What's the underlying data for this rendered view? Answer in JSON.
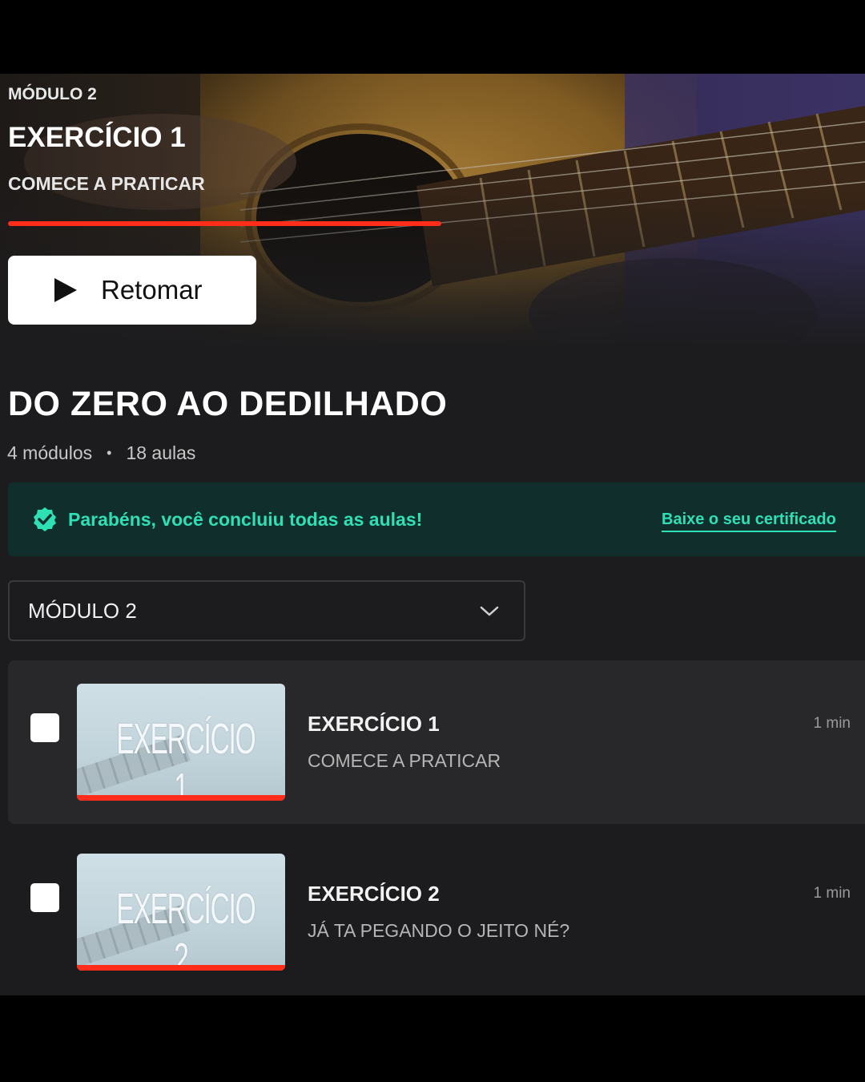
{
  "hero": {
    "module_label": "MÓDULO 2",
    "lesson_title": "EXERCÍCIO 1",
    "lesson_subtitle": "COMECE A PRATICAR",
    "progress": 1.0,
    "resume_label": "Retomar"
  },
  "course": {
    "title": "DO ZERO AO DEDILHADO",
    "modules": "4 módulos",
    "separator": "•",
    "lessons": "18 aulas"
  },
  "banner": {
    "message": "Parabéns, você concluiu todas as aulas!",
    "certificate_link": "Baixe o seu certificado",
    "accent_color": "#2fe0b5"
  },
  "module_select": {
    "selected": "MÓDULO 2"
  },
  "lessons": [
    {
      "thumb_text": "EXERCÍCIO 1",
      "title": "EXERCÍCIO 1",
      "subtitle": "COMECE A PRATICAR",
      "duration": "1 min",
      "progress": 1.0,
      "active": true
    },
    {
      "thumb_text": "EXERCÍCIO 2",
      "title": "EXERCÍCIO 2",
      "subtitle": "JÁ TA PEGANDO O JEITO NÉ?",
      "duration": "1 min",
      "progress": 1.0,
      "active": false
    }
  ],
  "colors": {
    "progress": "#ff2d1a",
    "background": "#1c1c1e"
  }
}
